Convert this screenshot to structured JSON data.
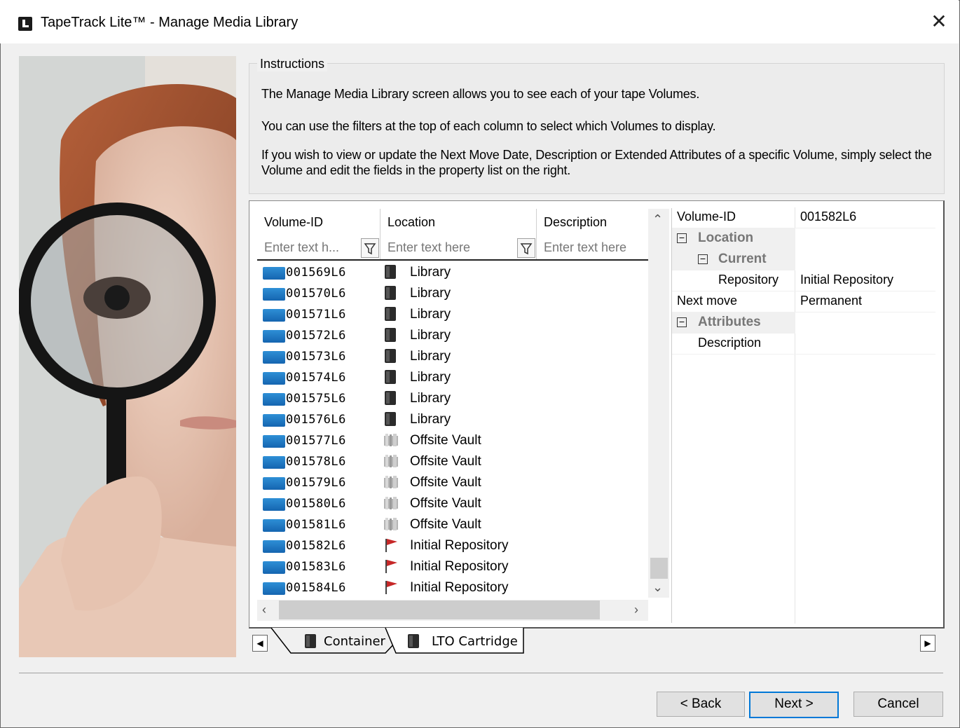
{
  "window": {
    "title": "TapeTrack Lite™ - Manage Media Library"
  },
  "instructions": {
    "legend": "Instructions",
    "p1": "The Manage Media Library screen allows you to see each of your tape Volumes.",
    "p2": "You can use the filters at the top of each column to select which Volumes to display.",
    "p3": "If you wish to view or update the Next Move Date, Description or Extended Attributes of a specific Volume, simply select the Volume and edit the fields in the property list on the right."
  },
  "grid": {
    "columns": [
      {
        "label": "Volume-ID",
        "filter_placeholder": "Enter text h..."
      },
      {
        "label": "Location",
        "filter_placeholder": "Enter text here"
      },
      {
        "label": "Description",
        "filter_placeholder": "Enter text here"
      }
    ],
    "rows": [
      {
        "id": "001569L6",
        "location": "Library",
        "loc_icon": "library-icon"
      },
      {
        "id": "001570L6",
        "location": "Library",
        "loc_icon": "library-icon"
      },
      {
        "id": "001571L6",
        "location": "Library",
        "loc_icon": "library-icon"
      },
      {
        "id": "001572L6",
        "location": "Library",
        "loc_icon": "library-icon"
      },
      {
        "id": "001573L6",
        "location": "Library",
        "loc_icon": "library-icon"
      },
      {
        "id": "001574L6",
        "location": "Library",
        "loc_icon": "library-icon"
      },
      {
        "id": "001575L6",
        "location": "Library",
        "loc_icon": "library-icon"
      },
      {
        "id": "001576L6",
        "location": "Library",
        "loc_icon": "library-icon"
      },
      {
        "id": "001577L6",
        "location": "Offsite Vault",
        "loc_icon": "vault-icon"
      },
      {
        "id": "001578L6",
        "location": "Offsite Vault",
        "loc_icon": "vault-icon"
      },
      {
        "id": "001579L6",
        "location": "Offsite Vault",
        "loc_icon": "vault-icon"
      },
      {
        "id": "001580L6",
        "location": "Offsite Vault",
        "loc_icon": "vault-icon"
      },
      {
        "id": "001581L6",
        "location": "Offsite Vault",
        "loc_icon": "vault-icon"
      },
      {
        "id": "001582L6",
        "location": "Initial Repository",
        "loc_icon": "flag-icon"
      },
      {
        "id": "001583L6",
        "location": "Initial Repository",
        "loc_icon": "flag-icon"
      },
      {
        "id": "001584L6",
        "location": "Initial Repository",
        "loc_icon": "flag-icon"
      }
    ]
  },
  "properties": {
    "volume_id_label": "Volume-ID",
    "volume_id_value": "001582L6",
    "location_cat": "Location",
    "current_cat": "Current",
    "repository_label": "Repository",
    "repository_value": "Initial Repository",
    "next_move_label": "Next move",
    "next_move_value": "Permanent",
    "attributes_cat": "Attributes",
    "description_label": "Description",
    "description_value": ""
  },
  "tabs": [
    {
      "label": "Container"
    },
    {
      "label": "LTO Cartridge"
    }
  ],
  "buttons": {
    "back": "< Back",
    "next": "Next >",
    "cancel": "Cancel"
  },
  "colors": {
    "tape": "#1e78c8",
    "flag": "#c62828",
    "accent": "#0078d7"
  }
}
